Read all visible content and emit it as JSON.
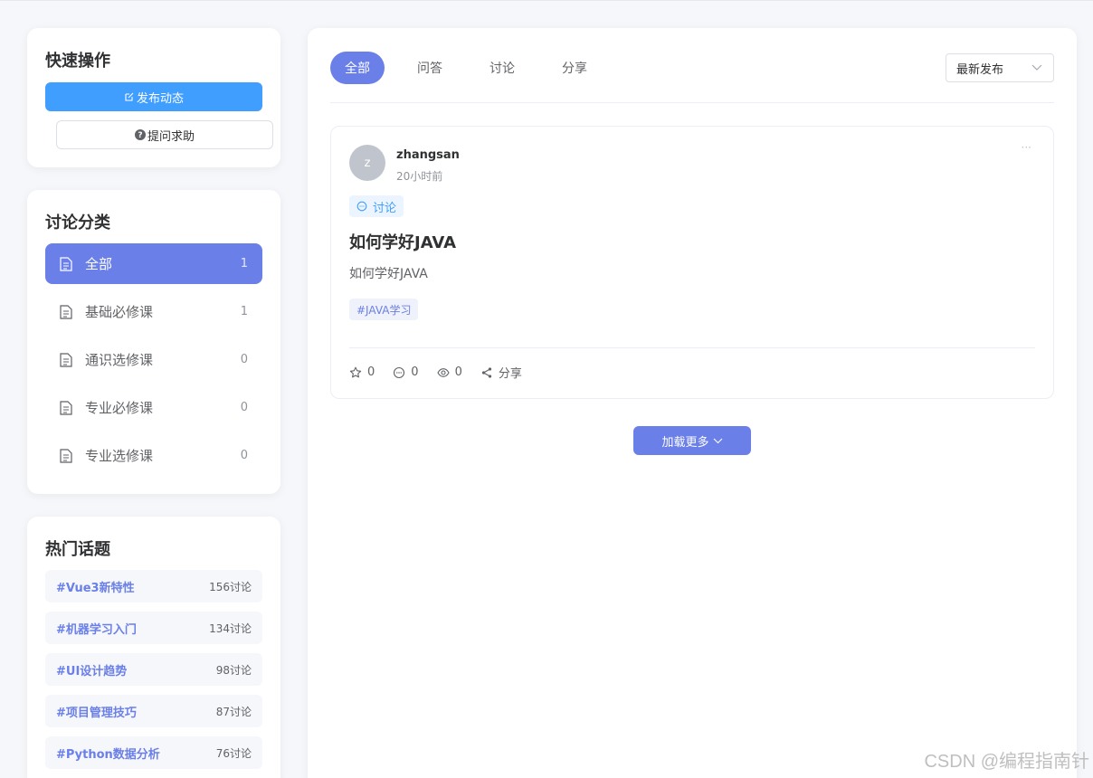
{
  "quick_actions": {
    "title": "快速操作",
    "post_label": "发布动态",
    "ask_label": "提问求助"
  },
  "categories": {
    "title": "讨论分类",
    "items": [
      {
        "label": "全部",
        "count": "1"
      },
      {
        "label": "基础必修课",
        "count": "1"
      },
      {
        "label": "通识选修课",
        "count": "0"
      },
      {
        "label": "专业必修课",
        "count": "0"
      },
      {
        "label": "专业选修课",
        "count": "0"
      }
    ]
  },
  "hot_topics": {
    "title": "热门话题",
    "items": [
      {
        "name": "#Vue3新特性",
        "count": "156讨论"
      },
      {
        "name": "#机器学习入门",
        "count": "134讨论"
      },
      {
        "name": "#UI设计趋势",
        "count": "98讨论"
      },
      {
        "name": "#项目管理技巧",
        "count": "87讨论"
      },
      {
        "name": "#Python数据分析",
        "count": "76讨论"
      }
    ]
  },
  "tabs": [
    {
      "label": "全部",
      "active": true
    },
    {
      "label": "问答",
      "active": false
    },
    {
      "label": "讨论",
      "active": false
    },
    {
      "label": "分享",
      "active": false
    }
  ],
  "sort": {
    "selected": "最新发布"
  },
  "post": {
    "avatar_letter": "z",
    "author": "zhangsan",
    "time": "20小时前",
    "more": "···",
    "type": "讨论",
    "title": "如何学好JAVA",
    "body": "如何学好JAVA",
    "tag": "#JAVA学习",
    "likes": "0",
    "comments": "0",
    "views": "0",
    "share_label": "分享"
  },
  "load_more_label": "加载更多",
  "watermark": "CSDN @编程指南针",
  "colors": {
    "primary": "#409eff",
    "accent": "#6a7fe8",
    "background": "#f5f7fa"
  }
}
